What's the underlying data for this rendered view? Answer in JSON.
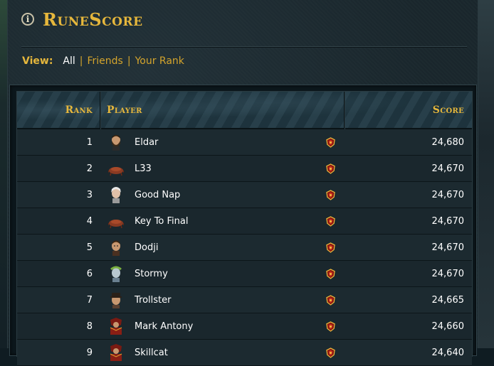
{
  "header": {
    "title": "RuneScore",
    "info_icon": "info-icon"
  },
  "view": {
    "label": "View:",
    "options": [
      {
        "label": "All",
        "active": true
      },
      {
        "label": "Friends",
        "active": false
      },
      {
        "label": "Your Rank",
        "active": false
      }
    ],
    "separator": "|"
  },
  "table": {
    "headers": {
      "rank": "Rank",
      "player": "Player",
      "score": "Score"
    },
    "rows": [
      {
        "rank": "1",
        "name": "Eldar",
        "score": "24,680",
        "avatar": "human-bearded-avatar",
        "badge": "runescore-badge-icon"
      },
      {
        "rank": "2",
        "name": "L33",
        "score": "24,670",
        "avatar": "crab-avatar",
        "badge": "runescore-badge-icon"
      },
      {
        "rank": "3",
        "name": "Good Nap",
        "score": "24,670",
        "avatar": "white-haired-avatar",
        "badge": "runescore-badge-icon"
      },
      {
        "rank": "4",
        "name": "Key To Final",
        "score": "24,670",
        "avatar": "crab-avatar",
        "badge": "runescore-badge-icon"
      },
      {
        "rank": "5",
        "name": "Dodji",
        "score": "24,670",
        "avatar": "human-avatar",
        "badge": "runescore-badge-icon"
      },
      {
        "rank": "6",
        "name": "Stormy",
        "score": "24,670",
        "avatar": "pale-wreath-avatar",
        "badge": "runescore-badge-icon"
      },
      {
        "rank": "7",
        "name": "Trollster",
        "score": "24,665",
        "avatar": "hat-avatar",
        "badge": "runescore-badge-icon"
      },
      {
        "rank": "8",
        "name": "Mark Antony",
        "score": "24,660",
        "avatar": "red-armor-avatar",
        "badge": "runescore-badge-icon"
      },
      {
        "rank": "9",
        "name": "Skillcat",
        "score": "24,640",
        "avatar": "red-armor-avatar",
        "badge": "runescore-badge-icon"
      }
    ]
  },
  "colors": {
    "accent": "#e6b73c",
    "text": "#ffffff",
    "panel": "#1a272d"
  }
}
